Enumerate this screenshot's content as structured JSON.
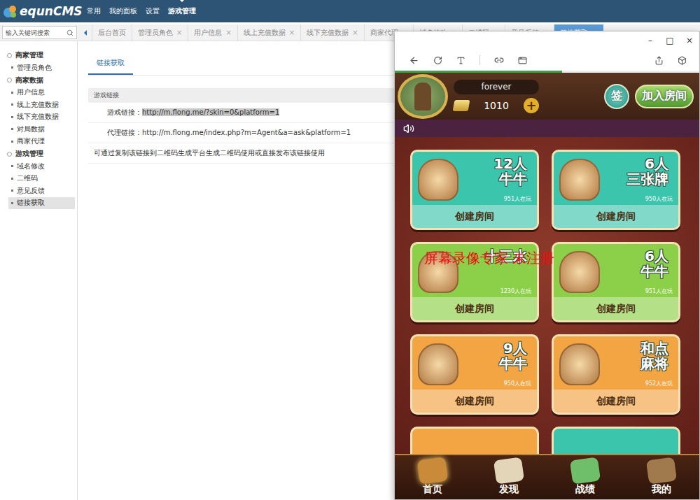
{
  "header": {
    "logo": "equnCMS",
    "nav": [
      {
        "label": "常用",
        "selected": false
      },
      {
        "label": "我的面板",
        "selected": false
      },
      {
        "label": "设置",
        "selected": false
      },
      {
        "label": "游戏管理",
        "selected": true
      }
    ]
  },
  "search": {
    "placeholder": "输入关键词搜索"
  },
  "tabs": [
    {
      "label": "后台首页",
      "close": "",
      "selected": false
    },
    {
      "label": "管理员角色",
      "close": "×",
      "selected": false
    },
    {
      "label": "用户信息",
      "close": "×",
      "selected": false
    },
    {
      "label": "线上充值数据",
      "close": "×",
      "selected": false
    },
    {
      "label": "线下充值数据",
      "close": "×",
      "selected": false
    },
    {
      "label": "商家代理",
      "close": "×",
      "selected": false
    },
    {
      "label": "域名修改",
      "close": "×",
      "selected": false
    },
    {
      "label": "二维码",
      "close": "×",
      "selected": false
    },
    {
      "label": "意见反馈",
      "close": "×",
      "selected": false
    },
    {
      "label": "链接获取",
      "close": "×",
      "selected": true
    }
  ],
  "sidebar": [
    {
      "group": "商家管理",
      "items": [
        {
          "label": "管理员角色",
          "selected": false
        }
      ]
    },
    {
      "group": "商家数据",
      "items": [
        {
          "label": "用户信息",
          "selected": false
        },
        {
          "label": "线上充值数据",
          "selected": false
        },
        {
          "label": "线下充值数据",
          "selected": false
        },
        {
          "label": "对局数据",
          "selected": false
        },
        {
          "label": "商家代理",
          "selected": false
        }
      ]
    },
    {
      "group": "游戏管理",
      "items": [
        {
          "label": "域名修改",
          "selected": false
        },
        {
          "label": "二维码",
          "selected": false
        },
        {
          "label": "意见反馈",
          "selected": false
        },
        {
          "label": "链接获取",
          "selected": true
        }
      ]
    }
  ],
  "content": {
    "tab": "链接获取",
    "section": "游戏链接",
    "links": [
      {
        "label": "游戏链接：",
        "url": "http://m.flong.me/?skin=0&platform=1",
        "highlighted": true
      },
      {
        "label": "代理链接：",
        "url": "http://m.flong.me/index.php?m=Agent&a=ask&platform=1",
        "highlighted": false
      }
    ],
    "note": "可通过复制该链接到二维码生成平台生成二维码使用或直接发布该链接使用"
  },
  "browser": {
    "controls": [
      "–",
      "□",
      "×"
    ],
    "loading": 0.55
  },
  "game": {
    "player": {
      "name": "forever",
      "gems": "1010",
      "plus": "+"
    },
    "sign": "签",
    "join": "加入房间",
    "games": [
      {
        "kind": "full",
        "lines": [
          "12人",
          "牛牛"
        ],
        "players": "951人在玩",
        "button": "创建房间",
        "color": "#3cc5ad"
      },
      {
        "kind": "full",
        "lines": [
          "6人",
          "三张牌"
        ],
        "players": "950人在玩",
        "button": "创建房间",
        "color": "#3cc5ad"
      },
      {
        "kind": "full",
        "lines": [
          "十三水"
        ],
        "players": "1230人在玩",
        "button": "创建房间",
        "color": "#8ccf48"
      },
      {
        "kind": "full",
        "lines": [
          "6人",
          "牛牛"
        ],
        "players": "951人在玩",
        "button": "创建房间",
        "color": "#8ccf48"
      },
      {
        "kind": "full",
        "lines": [
          "9人",
          "牛牛"
        ],
        "players": "950人在玩",
        "button": "创建房间",
        "color": "#f3a443"
      },
      {
        "kind": "full",
        "lines": [
          "和点",
          "麻将"
        ],
        "players": "952人在玩",
        "button": "创建房间",
        "color": "#f3a443"
      },
      {
        "kind": "partial",
        "color": "#f3a443"
      },
      {
        "kind": "partial",
        "color": "#3cc5ad"
      }
    ],
    "nav": [
      {
        "label": "首页",
        "selected": true,
        "color": "#c98a3a"
      },
      {
        "label": "发现",
        "selected": false,
        "color": "#e3d6b8"
      },
      {
        "label": "战绩",
        "selected": false,
        "color": "#6fbf6a"
      },
      {
        "label": "我的",
        "selected": false,
        "color": "#a07a4c"
      }
    ]
  },
  "watermark": "屏幕录像专家 未注册"
}
